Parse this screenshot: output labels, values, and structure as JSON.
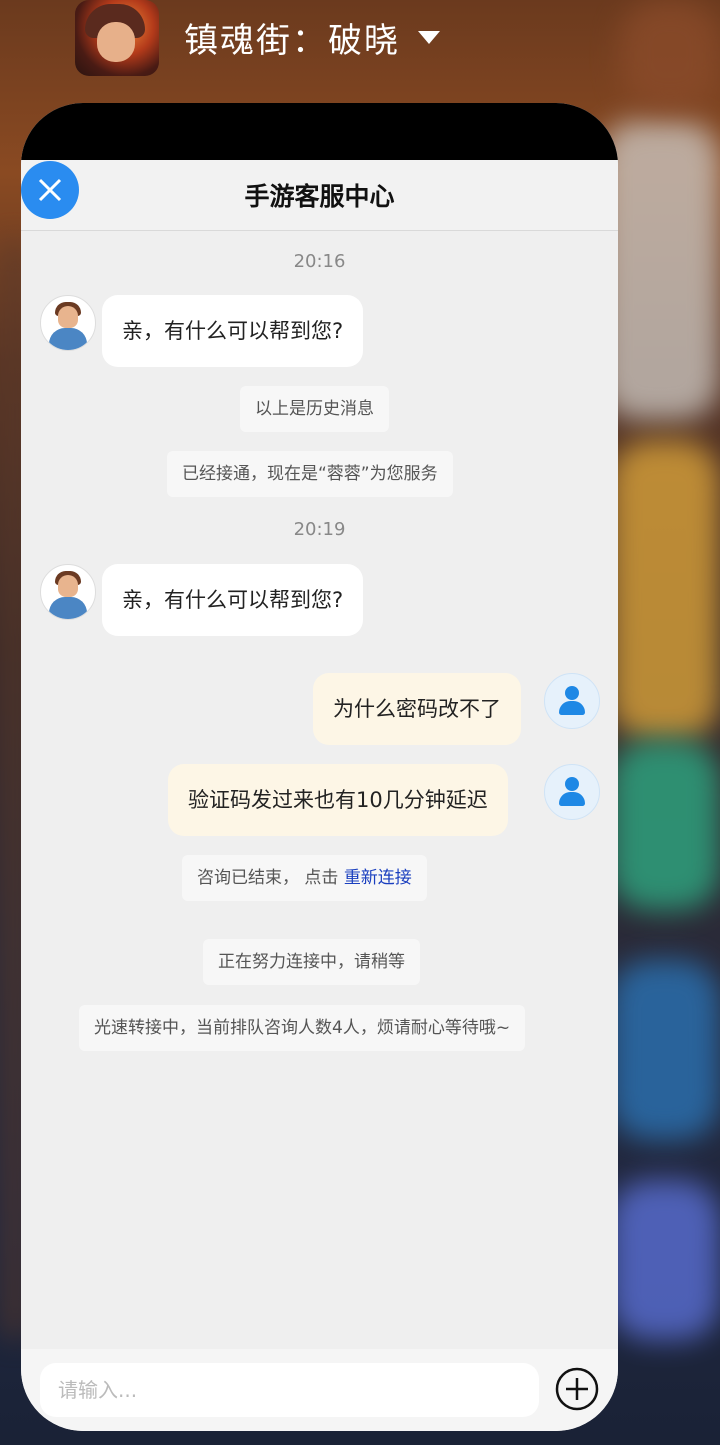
{
  "app": {
    "name": "镇魂街：破晓",
    "icon": "game-app-icon",
    "caret_icon": "caret-down-icon"
  },
  "window": {
    "title": "手游客服中心",
    "close_icon": "close-icon",
    "accent": "#2a8cf0"
  },
  "messages": {
    "ts1": "20:16",
    "agent_msg_1": "亲，有什么可以帮到您?",
    "history_note": "以上是历史消息",
    "connected_note": "已经接通，现在是“蓉蓉”为您服务",
    "ts2": "20:19",
    "agent_msg_2": "亲，有什么可以帮到您?",
    "user_msg_1": "为什么密码改不了",
    "user_msg_2": "验证码发过来也有10几分钟延迟",
    "ended_note": "咨询已结束，  点击",
    "reconnect_link": "重新连接",
    "connecting_note": "正在努力连接中，请稍等",
    "queue_note": "光速转接中，当前排队咨询人数4人，烦请耐心等待哦~"
  },
  "input": {
    "placeholder": "请输入...",
    "value": "",
    "plus_icon": "plus-circle-icon"
  }
}
